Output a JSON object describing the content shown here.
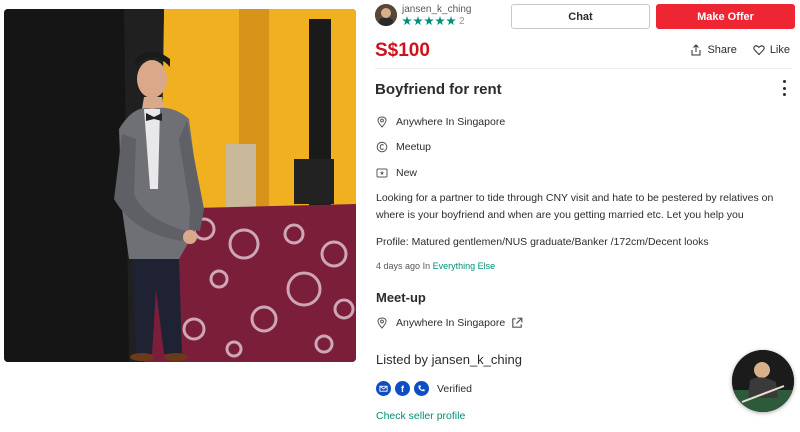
{
  "listing": {
    "seller": {
      "username": "jansen_k_ching",
      "rating_stars": 5,
      "review_count": "2"
    },
    "buttons": {
      "chat": "Chat",
      "make_offer": "Make Offer"
    },
    "price": "S$100",
    "actions": {
      "share": "Share",
      "like": "Like"
    },
    "title": "Boyfriend for rent",
    "details": {
      "location": "Anywhere In Singapore",
      "deal_method": "Meetup",
      "condition": "New"
    },
    "description": "Looking for a partner to tide through CNY visit and hate to be pestered by relatives on where is your boyfriend and when are you getting married etc. Let you help you",
    "profile_line": "Profile: Matured gentlemen/NUS graduate/Banker /172cm/Decent looks",
    "posted": {
      "time": "4 days ago",
      "in_label": "In",
      "category": "Everything Else"
    },
    "meetup": {
      "heading": "Meet-up",
      "location": "Anywhere In Singapore"
    },
    "listed_by": "Listed by jansen_k_ching",
    "verified_label": "Verified",
    "check_profile": "Check seller profile"
  },
  "icons": {
    "star": "star-icon",
    "share": "share-icon",
    "like": "heart-icon",
    "more": "more-vertical-icon",
    "location": "location-pin-icon",
    "meetup": "meetup-icon",
    "condition": "condition-tag-icon",
    "external": "external-link-icon",
    "email_verify": "email-icon",
    "facebook_verify": "facebook-icon",
    "phone_verify": "phone-icon"
  },
  "colors": {
    "price": "#d0101c",
    "offer_button": "#ee2533",
    "accent_green": "#008f79",
    "verify_blue": "#0d4ec4"
  }
}
